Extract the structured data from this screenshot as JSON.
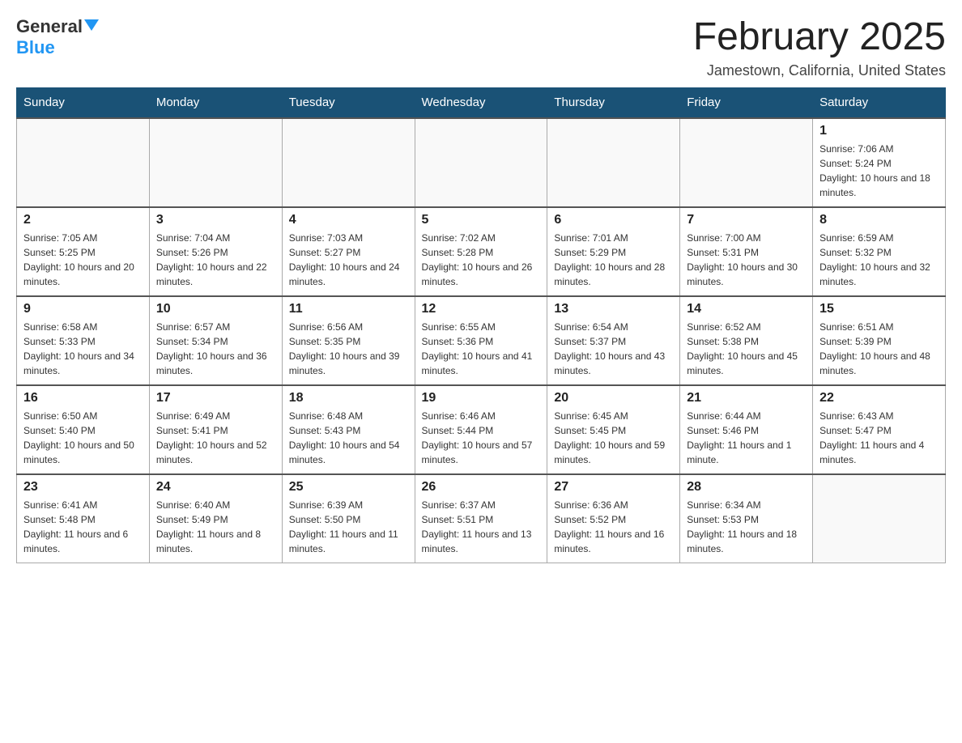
{
  "logo": {
    "general": "General",
    "blue": "Blue"
  },
  "header": {
    "month_year": "February 2025",
    "location": "Jamestown, California, United States"
  },
  "weekdays": [
    "Sunday",
    "Monday",
    "Tuesday",
    "Wednesday",
    "Thursday",
    "Friday",
    "Saturday"
  ],
  "weeks": [
    [
      {
        "day": "",
        "sunrise": "",
        "sunset": "",
        "daylight": ""
      },
      {
        "day": "",
        "sunrise": "",
        "sunset": "",
        "daylight": ""
      },
      {
        "day": "",
        "sunrise": "",
        "sunset": "",
        "daylight": ""
      },
      {
        "day": "",
        "sunrise": "",
        "sunset": "",
        "daylight": ""
      },
      {
        "day": "",
        "sunrise": "",
        "sunset": "",
        "daylight": ""
      },
      {
        "day": "",
        "sunrise": "",
        "sunset": "",
        "daylight": ""
      },
      {
        "day": "1",
        "sunrise": "Sunrise: 7:06 AM",
        "sunset": "Sunset: 5:24 PM",
        "daylight": "Daylight: 10 hours and 18 minutes."
      }
    ],
    [
      {
        "day": "2",
        "sunrise": "Sunrise: 7:05 AM",
        "sunset": "Sunset: 5:25 PM",
        "daylight": "Daylight: 10 hours and 20 minutes."
      },
      {
        "day": "3",
        "sunrise": "Sunrise: 7:04 AM",
        "sunset": "Sunset: 5:26 PM",
        "daylight": "Daylight: 10 hours and 22 minutes."
      },
      {
        "day": "4",
        "sunrise": "Sunrise: 7:03 AM",
        "sunset": "Sunset: 5:27 PM",
        "daylight": "Daylight: 10 hours and 24 minutes."
      },
      {
        "day": "5",
        "sunrise": "Sunrise: 7:02 AM",
        "sunset": "Sunset: 5:28 PM",
        "daylight": "Daylight: 10 hours and 26 minutes."
      },
      {
        "day": "6",
        "sunrise": "Sunrise: 7:01 AM",
        "sunset": "Sunset: 5:29 PM",
        "daylight": "Daylight: 10 hours and 28 minutes."
      },
      {
        "day": "7",
        "sunrise": "Sunrise: 7:00 AM",
        "sunset": "Sunset: 5:31 PM",
        "daylight": "Daylight: 10 hours and 30 minutes."
      },
      {
        "day": "8",
        "sunrise": "Sunrise: 6:59 AM",
        "sunset": "Sunset: 5:32 PM",
        "daylight": "Daylight: 10 hours and 32 minutes."
      }
    ],
    [
      {
        "day": "9",
        "sunrise": "Sunrise: 6:58 AM",
        "sunset": "Sunset: 5:33 PM",
        "daylight": "Daylight: 10 hours and 34 minutes."
      },
      {
        "day": "10",
        "sunrise": "Sunrise: 6:57 AM",
        "sunset": "Sunset: 5:34 PM",
        "daylight": "Daylight: 10 hours and 36 minutes."
      },
      {
        "day": "11",
        "sunrise": "Sunrise: 6:56 AM",
        "sunset": "Sunset: 5:35 PM",
        "daylight": "Daylight: 10 hours and 39 minutes."
      },
      {
        "day": "12",
        "sunrise": "Sunrise: 6:55 AM",
        "sunset": "Sunset: 5:36 PM",
        "daylight": "Daylight: 10 hours and 41 minutes."
      },
      {
        "day": "13",
        "sunrise": "Sunrise: 6:54 AM",
        "sunset": "Sunset: 5:37 PM",
        "daylight": "Daylight: 10 hours and 43 minutes."
      },
      {
        "day": "14",
        "sunrise": "Sunrise: 6:52 AM",
        "sunset": "Sunset: 5:38 PM",
        "daylight": "Daylight: 10 hours and 45 minutes."
      },
      {
        "day": "15",
        "sunrise": "Sunrise: 6:51 AM",
        "sunset": "Sunset: 5:39 PM",
        "daylight": "Daylight: 10 hours and 48 minutes."
      }
    ],
    [
      {
        "day": "16",
        "sunrise": "Sunrise: 6:50 AM",
        "sunset": "Sunset: 5:40 PM",
        "daylight": "Daylight: 10 hours and 50 minutes."
      },
      {
        "day": "17",
        "sunrise": "Sunrise: 6:49 AM",
        "sunset": "Sunset: 5:41 PM",
        "daylight": "Daylight: 10 hours and 52 minutes."
      },
      {
        "day": "18",
        "sunrise": "Sunrise: 6:48 AM",
        "sunset": "Sunset: 5:43 PM",
        "daylight": "Daylight: 10 hours and 54 minutes."
      },
      {
        "day": "19",
        "sunrise": "Sunrise: 6:46 AM",
        "sunset": "Sunset: 5:44 PM",
        "daylight": "Daylight: 10 hours and 57 minutes."
      },
      {
        "day": "20",
        "sunrise": "Sunrise: 6:45 AM",
        "sunset": "Sunset: 5:45 PM",
        "daylight": "Daylight: 10 hours and 59 minutes."
      },
      {
        "day": "21",
        "sunrise": "Sunrise: 6:44 AM",
        "sunset": "Sunset: 5:46 PM",
        "daylight": "Daylight: 11 hours and 1 minute."
      },
      {
        "day": "22",
        "sunrise": "Sunrise: 6:43 AM",
        "sunset": "Sunset: 5:47 PM",
        "daylight": "Daylight: 11 hours and 4 minutes."
      }
    ],
    [
      {
        "day": "23",
        "sunrise": "Sunrise: 6:41 AM",
        "sunset": "Sunset: 5:48 PM",
        "daylight": "Daylight: 11 hours and 6 minutes."
      },
      {
        "day": "24",
        "sunrise": "Sunrise: 6:40 AM",
        "sunset": "Sunset: 5:49 PM",
        "daylight": "Daylight: 11 hours and 8 minutes."
      },
      {
        "day": "25",
        "sunrise": "Sunrise: 6:39 AM",
        "sunset": "Sunset: 5:50 PM",
        "daylight": "Daylight: 11 hours and 11 minutes."
      },
      {
        "day": "26",
        "sunrise": "Sunrise: 6:37 AM",
        "sunset": "Sunset: 5:51 PM",
        "daylight": "Daylight: 11 hours and 13 minutes."
      },
      {
        "day": "27",
        "sunrise": "Sunrise: 6:36 AM",
        "sunset": "Sunset: 5:52 PM",
        "daylight": "Daylight: 11 hours and 16 minutes."
      },
      {
        "day": "28",
        "sunrise": "Sunrise: 6:34 AM",
        "sunset": "Sunset: 5:53 PM",
        "daylight": "Daylight: 11 hours and 18 minutes."
      },
      {
        "day": "",
        "sunrise": "",
        "sunset": "",
        "daylight": ""
      }
    ]
  ]
}
